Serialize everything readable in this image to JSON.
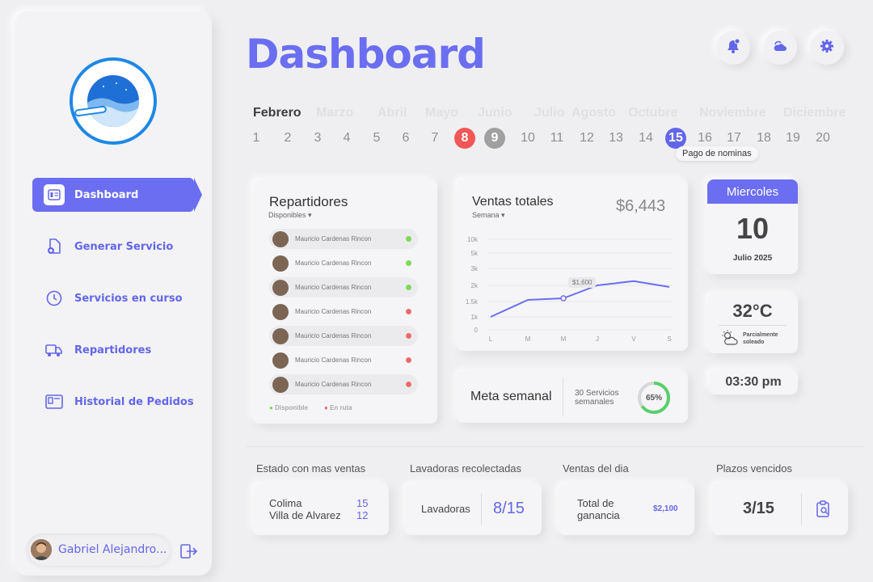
{
  "sidebar": {
    "nav": [
      {
        "label": "Dashboard",
        "icon": "dashboard-icon"
      },
      {
        "label": "Generar Servicio",
        "icon": "add-document-icon"
      },
      {
        "label": "Servicios en curso",
        "icon": "clock-icon"
      },
      {
        "label": "Repartidores",
        "icon": "truck-icon"
      },
      {
        "label": "Historial de Pedidos",
        "icon": "history-icon"
      }
    ],
    "user_name": "Gabriel Alejandro..."
  },
  "header": {
    "title": "Dashboard",
    "icons": [
      "notification-icon",
      "weather-icon",
      "settings-icon"
    ]
  },
  "timeline": {
    "months": [
      "Febrero",
      "Marzo",
      "Abril",
      "Mayo",
      "Junio",
      "Julio",
      "Agosto",
      "Octubre",
      "Noviembre",
      "Diciembre"
    ],
    "days": [
      "1",
      "2",
      "3",
      "4",
      "5",
      "6",
      "7",
      "8",
      "9",
      "10",
      "11",
      "12",
      "13",
      "14",
      "15",
      "16",
      "17",
      "18",
      "19",
      "20"
    ],
    "tooltip": "Pago de nominas"
  },
  "repartidores": {
    "title": "Repartidores",
    "filter": "Disponibles",
    "rows": [
      {
        "name": "Mauricio Cardenas Rincon",
        "status": "green"
      },
      {
        "name": "Mauricio Cardenas Rincon",
        "status": "green"
      },
      {
        "name": "Mauricio Cardenas Rincon",
        "status": "green"
      },
      {
        "name": "Mauricio Cardenas Rincon",
        "status": "red"
      },
      {
        "name": "Mauricio Cardenas Rincon",
        "status": "red"
      },
      {
        "name": "Mauricio Cardenas Rincon",
        "status": "red"
      },
      {
        "name": "Mauricio Cardenas Rincon",
        "status": "red"
      }
    ],
    "legend_available": "Disponible",
    "legend_route": "En ruta",
    "colors": {
      "green": "#7ed957",
      "red": "#f26b6b"
    }
  },
  "ventas": {
    "title": "Ventas totales",
    "filter": "Semana",
    "total": "$6,443",
    "tooltip": "$1,600"
  },
  "chart_data": {
    "type": "line",
    "categories": [
      "L",
      "M",
      "M",
      "J",
      "V",
      "S"
    ],
    "y_ticks": [
      "10k",
      "5k",
      "3k",
      "2k",
      "1.5k",
      "1k",
      "0"
    ],
    "series": [
      {
        "values": [
          1000,
          1550,
          1600,
          2000,
          2250,
          1950
        ]
      }
    ]
  },
  "meta": {
    "title": "Meta semanal",
    "desc": "30 Servicios semanales",
    "percent": "65%",
    "progress": 0.65
  },
  "date_card": {
    "day_name": "Miercoles",
    "day": "10",
    "month_year": "Julio 2025"
  },
  "weather": {
    "temp": "32°C",
    "desc": "Parcialmente soleado"
  },
  "time": "03:30 pm",
  "bottom": {
    "estado": {
      "label": "Estado con mas ventas",
      "rows": [
        {
          "name": "Colima",
          "value": "15"
        },
        {
          "name": "Villa de Alvarez",
          "value": "12"
        }
      ]
    },
    "lavadoras": {
      "label": "Lavadoras recolectadas",
      "name": "Lavadoras",
      "value": "8/15"
    },
    "ventas_dia": {
      "label": "Ventas del dia",
      "name": "Total de ganancia",
      "value": "$2,100"
    },
    "plazos": {
      "label": "Plazos vencidos",
      "value": "3/15"
    }
  }
}
